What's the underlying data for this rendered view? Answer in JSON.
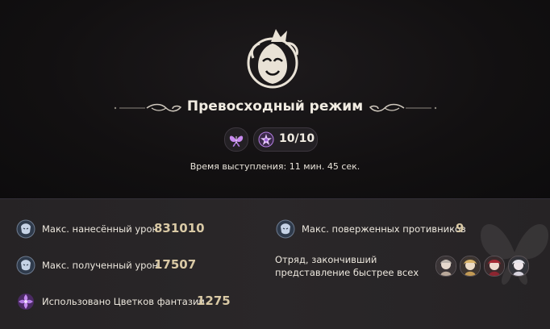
{
  "header": {
    "title": "Превосходный режим",
    "score": "10/10",
    "performance_time": "Время выступления: 11 мин. 45 сек."
  },
  "icons": {
    "emblem": "theater-mask-emblem-icon",
    "mode_badge": "butterfly-icon",
    "score_badge": "star-flower-icon"
  },
  "stats": {
    "max_damage_dealt": {
      "label": "Макс. нанесённый урон",
      "value": "831010"
    },
    "max_damage_taken": {
      "label": "Макс. полученный урон",
      "value": "17507"
    },
    "fantasia_flowers_used": {
      "label": "Использовано Цветков фантазии",
      "value": "1275"
    },
    "max_enemies_defeated": {
      "label": "Макс. поверженных противников",
      "value": "9"
    },
    "fastest_squad_label": "Отряд, закончивший представление быстрее всех"
  },
  "squad": [
    "character-avatar-1",
    "character-avatar-2",
    "character-avatar-3",
    "character-avatar-4"
  ],
  "colors": {
    "background": "#121011",
    "stats_background": "#2a2729",
    "text": "#ece7dd",
    "value_gold": "#d9c9a5",
    "accent_purple": "#c98cf0"
  }
}
